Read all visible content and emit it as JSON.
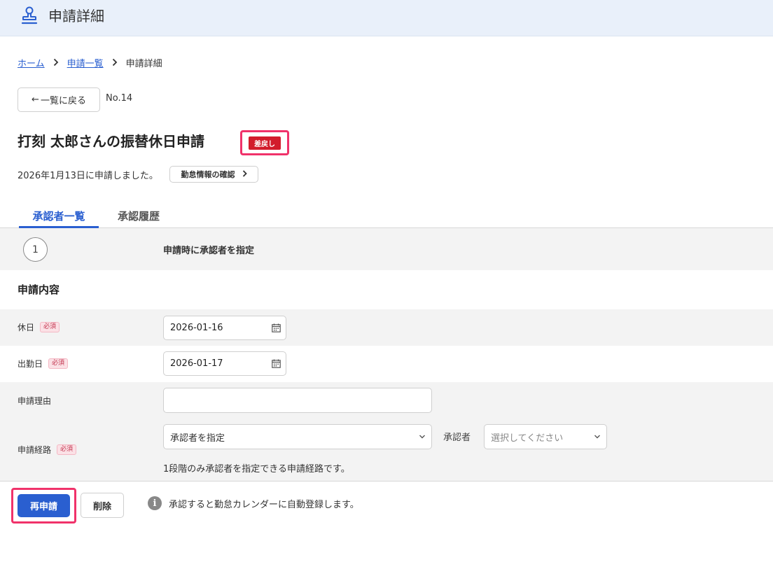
{
  "header": {
    "title": "申請詳細",
    "icon": "stamp-icon"
  },
  "breadcrumb": {
    "home": "ホーム",
    "list": "申請一覧",
    "current": "申請詳細"
  },
  "back_button": {
    "arrow": "←",
    "label": "一覧に戻る"
  },
  "request_no": "No.14",
  "request_title": "打刻 太郎さんの振替休日申請",
  "status": {
    "label": "差戻し",
    "color": "#d21c2c"
  },
  "applied_text": "2026年1月13日に申請しました。",
  "info_button": {
    "label": "勤怠情報の確認"
  },
  "tabs": [
    {
      "label": "承認者一覧",
      "active": true
    },
    {
      "label": "承認履歴",
      "active": false
    }
  ],
  "approvers": [
    {
      "step": "1",
      "text": "申請時に承認者を指定"
    }
  ],
  "section": {
    "title": "申請内容"
  },
  "form": {
    "required_label": "必須",
    "holiday": {
      "label": "休日",
      "value": "2026-01-16"
    },
    "workday": {
      "label": "出勤日",
      "value": "2026-01-17"
    },
    "reason": {
      "label": "申請理由",
      "value": ""
    },
    "route": {
      "label": "申請経路",
      "select_value": "承認者を指定",
      "approver_label": "承認者",
      "approver_placeholder": "選択してください",
      "note": "1段階のみ承認者を指定できる申請経路です。"
    }
  },
  "footer": {
    "resubmit_label": "再申請",
    "delete_label": "削除",
    "info_icon": "i",
    "note": "承認すると勤怠カレンダーに自動登録します。"
  },
  "colors": {
    "accent": "#2a5fd0",
    "highlight": "#f0326a",
    "header_bg": "#e9f0fa"
  }
}
